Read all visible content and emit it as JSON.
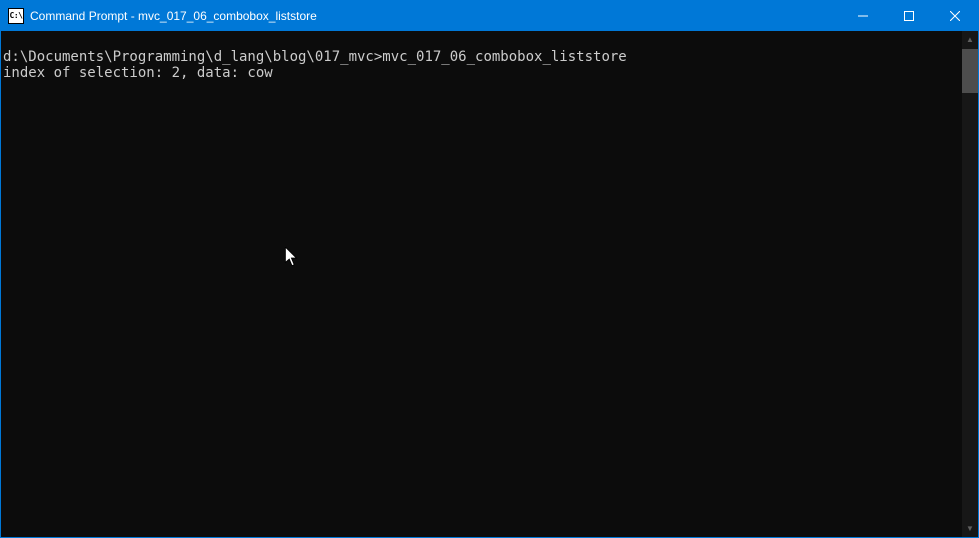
{
  "titlebar": {
    "icon_label": "C:\\",
    "title": "Command Prompt - mvc_017_06_combobox_liststore"
  },
  "terminal": {
    "line1_prompt": "d:\\Documents\\Programming\\d_lang\\blog\\017_mvc>",
    "line1_command": "mvc_017_06_combobox_liststore",
    "line2": "index of selection: 2, data: cow"
  }
}
